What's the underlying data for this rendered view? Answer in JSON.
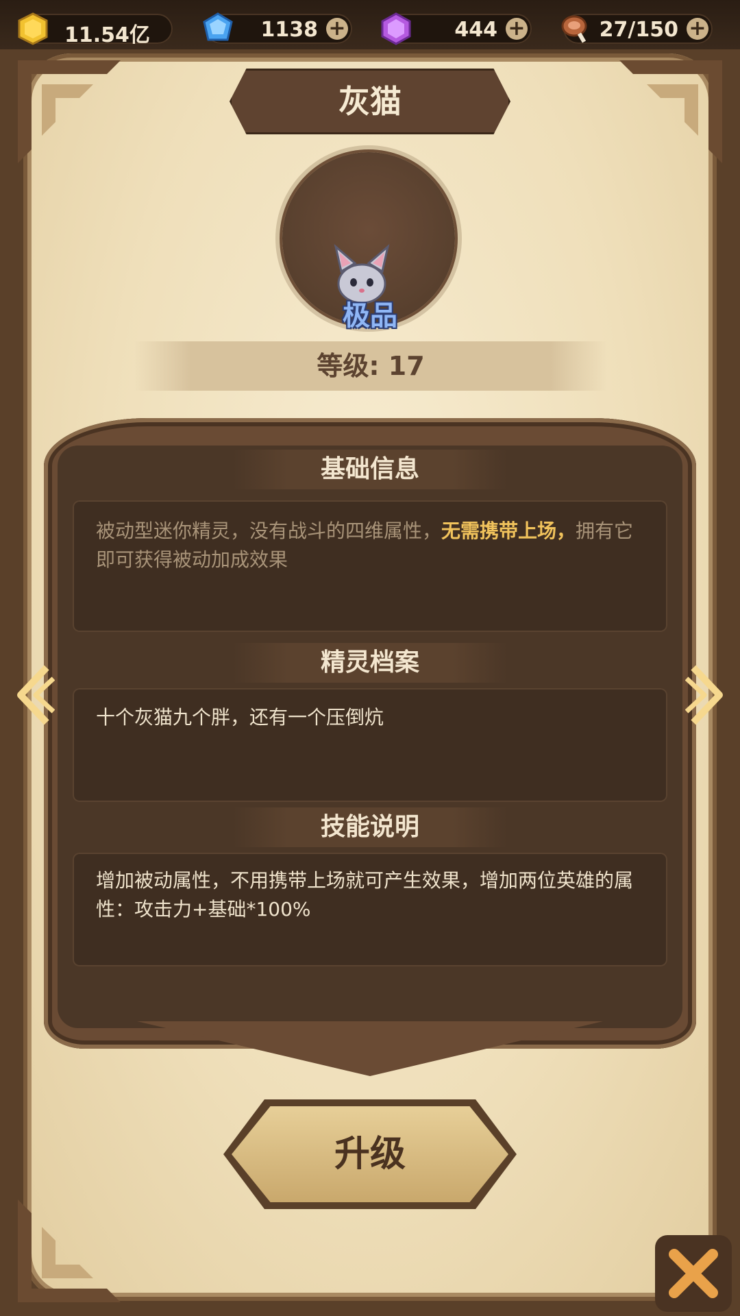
{
  "resources": {
    "gold": {
      "icon": "gold-coin-icon",
      "value": "11.54亿"
    },
    "diamond": {
      "icon": "blue-diamond-icon",
      "value": "1138"
    },
    "gem": {
      "icon": "purple-gem-icon",
      "value": "444"
    },
    "stamina": {
      "icon": "meat-icon",
      "value": "27/150"
    }
  },
  "pet": {
    "name": "灰猫",
    "grade": "极品",
    "level_label": "等级: 17"
  },
  "sections": {
    "basic": {
      "title": "基础信息",
      "text_before": "被动型迷你精灵，没有战斗的四维属性，",
      "text_highlight": "无需携带上场，",
      "text_after": "拥有它即可获得被动加成效果"
    },
    "profile": {
      "title": "精灵档案",
      "text": "十个灰猫九个胖，还有一个压倒炕"
    },
    "skill": {
      "title": "技能说明",
      "text": "增加被动属性，不用携带上场就可产生效果，增加两位英雄的属性：攻击力+基础*100%"
    }
  },
  "buttons": {
    "upgrade": "升级"
  },
  "colors": {
    "parchment": "#efdfba",
    "panel": "#4b3727",
    "highlight": "#f1c35c",
    "grade": "#8fb6f5"
  }
}
